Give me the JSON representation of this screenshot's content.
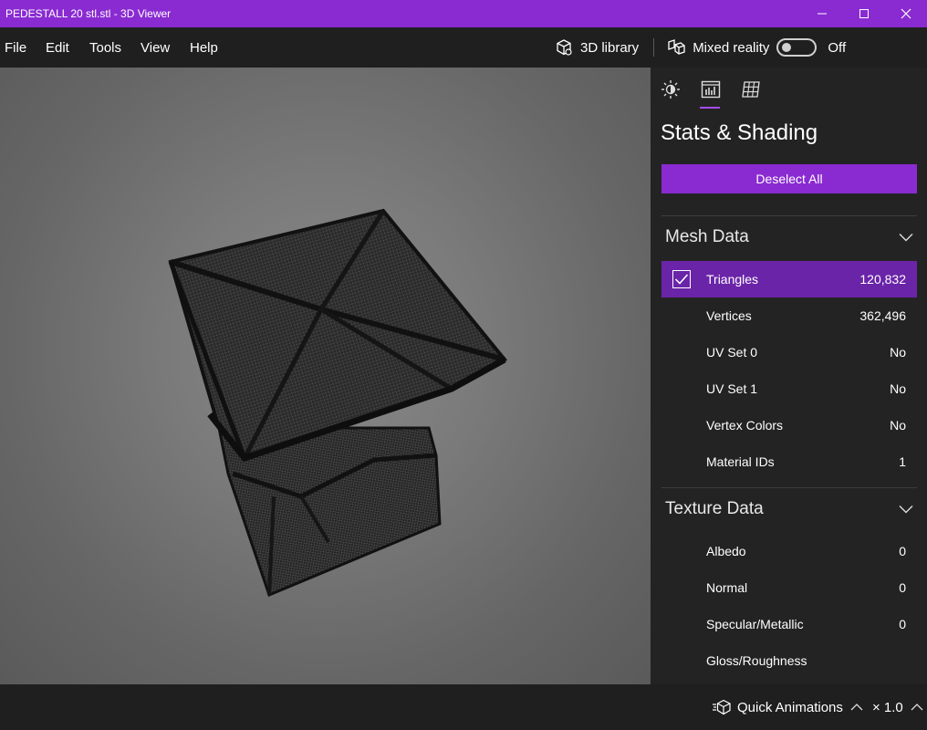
{
  "window": {
    "title": "PEDESTALL 20 stl.stl - 3D Viewer",
    "accent_color": "#8a2bd2"
  },
  "menu": {
    "items": [
      {
        "label": "File"
      },
      {
        "label": "Edit"
      },
      {
        "label": "Tools"
      },
      {
        "label": "View"
      },
      {
        "label": "Help"
      }
    ]
  },
  "toolbar": {
    "library_label": "3D library",
    "mixed_reality_label": "Mixed reality",
    "toggle_state_label": "Off",
    "toggle_on": false
  },
  "panel": {
    "tabs": [
      {
        "icon": "sun-icon",
        "name": "Lighting"
      },
      {
        "icon": "stats-icon",
        "name": "Stats & Shading",
        "active": true
      },
      {
        "icon": "grid-icon",
        "name": "Grid"
      }
    ],
    "title": "Stats & Shading",
    "deselect_label": "Deselect All",
    "mesh_section": {
      "title": "Mesh Data",
      "rows": [
        {
          "label": "Triangles",
          "value": "120,832",
          "checked": true
        },
        {
          "label": "Vertices",
          "value": "362,496"
        },
        {
          "label": "UV Set 0",
          "value": "No"
        },
        {
          "label": "UV Set 1",
          "value": "No"
        },
        {
          "label": "Vertex Colors",
          "value": "No"
        },
        {
          "label": "Material IDs",
          "value": "1"
        }
      ]
    },
    "texture_section": {
      "title": "Texture Data",
      "rows": [
        {
          "label": "Albedo",
          "value": "0"
        },
        {
          "label": "Normal",
          "value": "0"
        },
        {
          "label": "Specular/Metallic",
          "value": "0"
        },
        {
          "label": "Gloss/Roughness",
          "value": ""
        }
      ]
    }
  },
  "bottom": {
    "animations_label": "Quick Animations",
    "speed_label": "× 1.0"
  }
}
